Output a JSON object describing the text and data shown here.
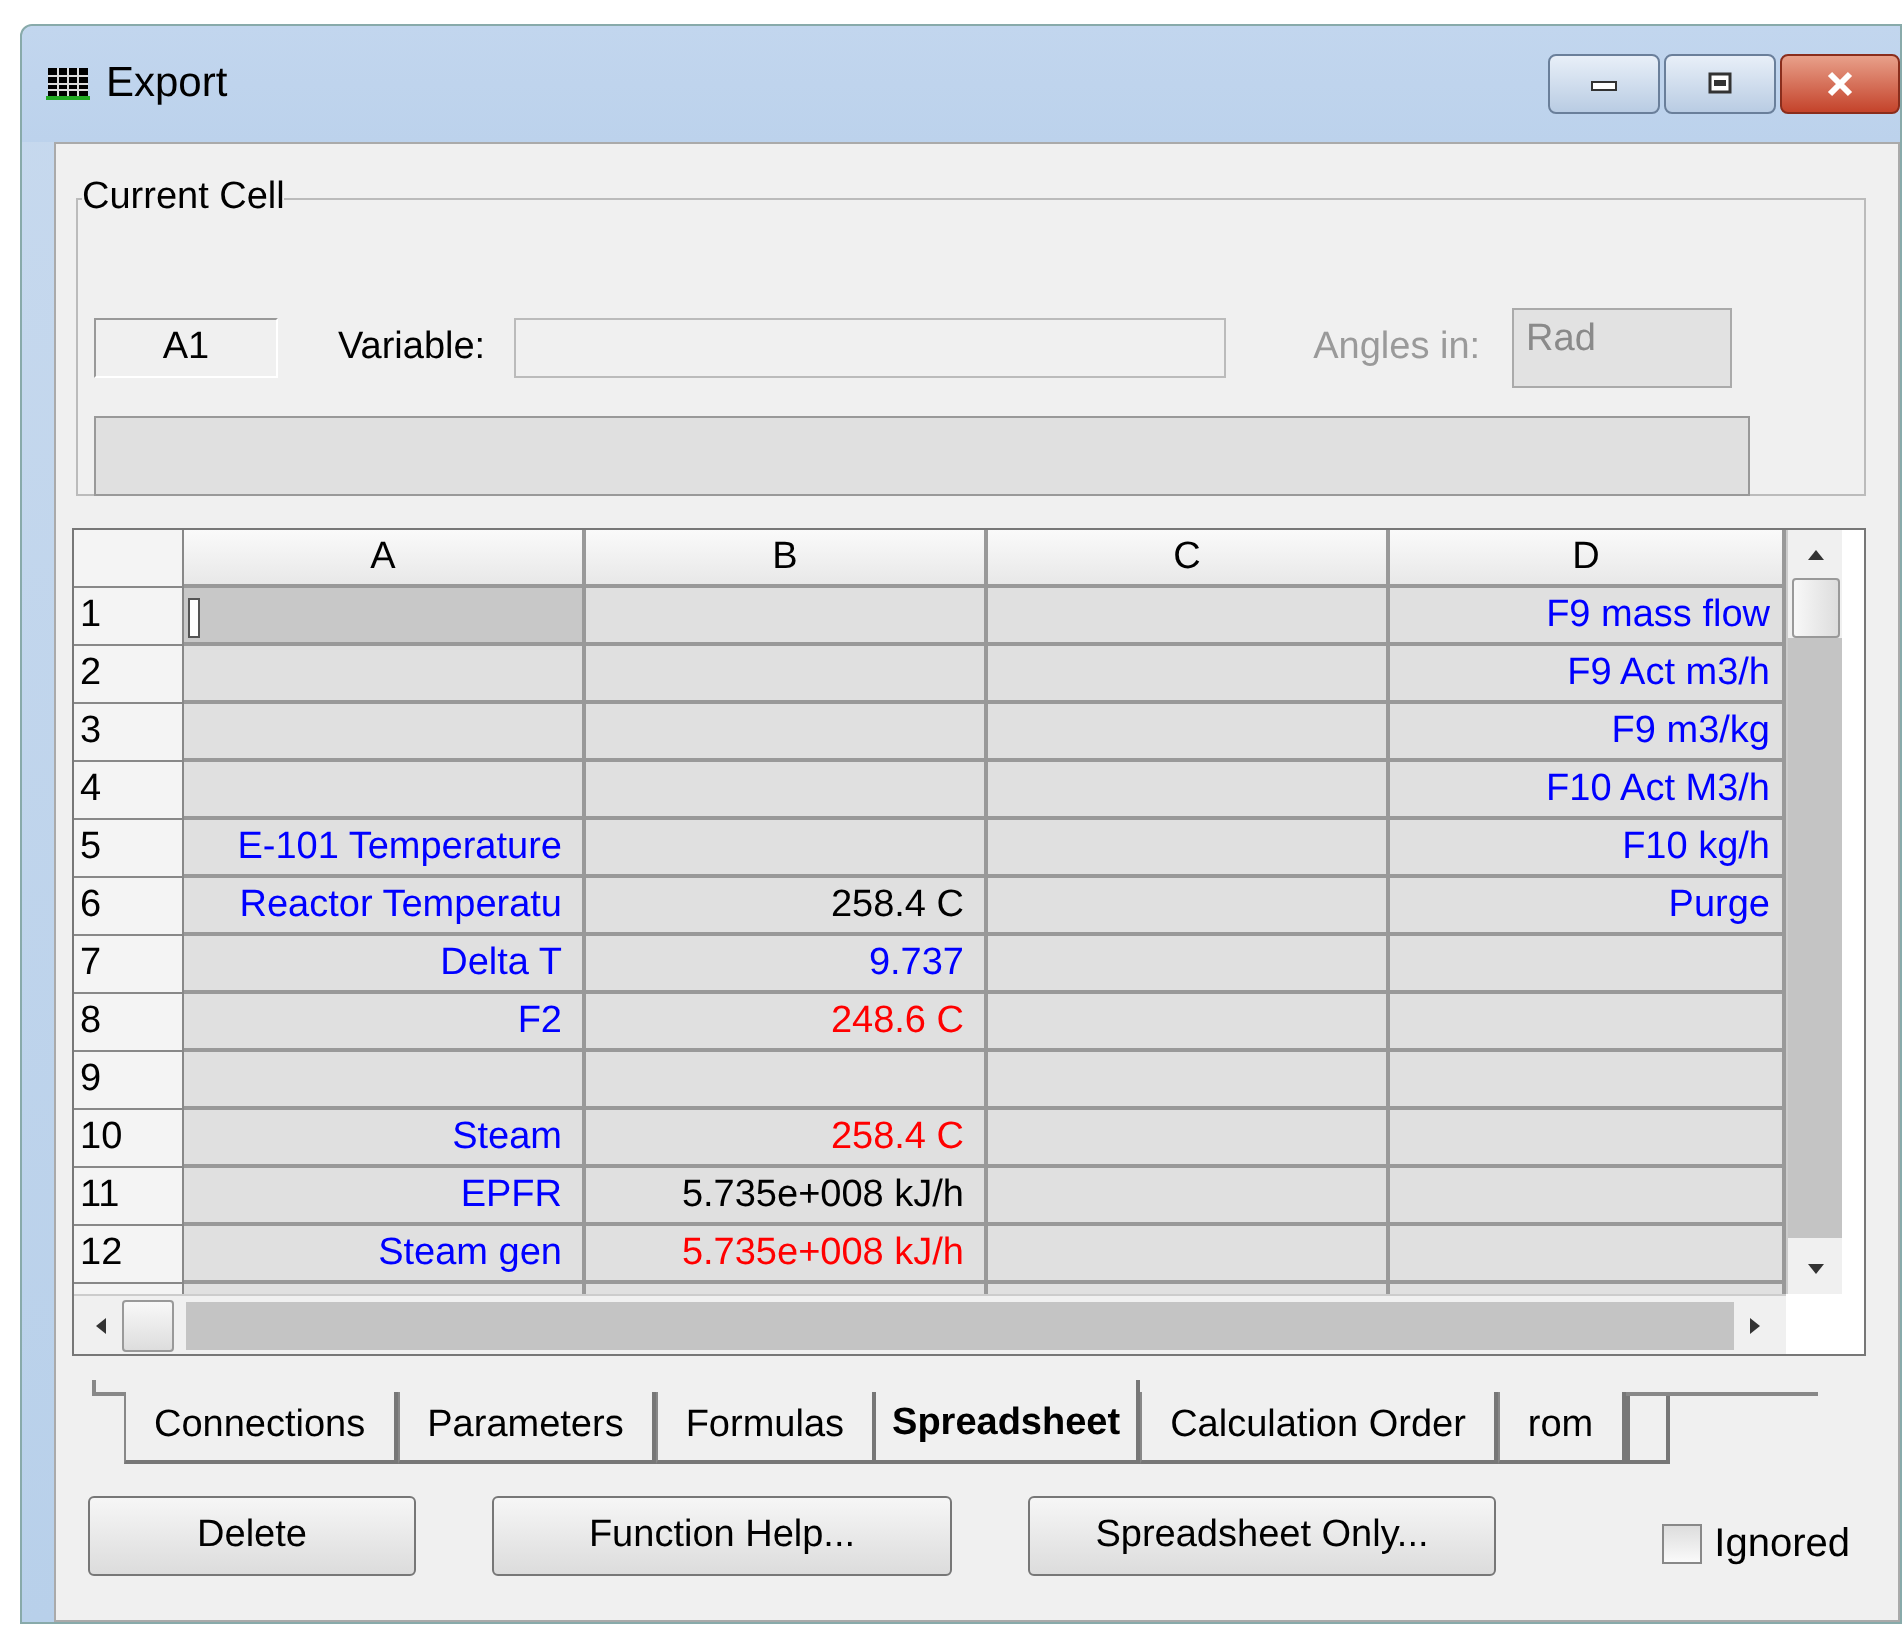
{
  "window": {
    "title": "Export"
  },
  "current_cell": {
    "legend": "Current Cell",
    "cell_ref": "A1",
    "variable_label": "Variable:",
    "angles_label": "Angles in:",
    "angles_value": "Rad"
  },
  "grid": {
    "columns": [
      "A",
      "B",
      "C",
      "D"
    ],
    "rows": [
      {
        "number": "1",
        "cells": [
          {
            "selected": true
          },
          {
            "selected": false
          },
          {
            "selected": false
          },
          {
            "selected": false,
            "text": "F9 mass flow",
            "color": "#0000ff"
          }
        ]
      },
      {
        "number": "2",
        "cells": [
          {
            "selected": false
          },
          {
            "selected": false
          },
          {
            "selected": false
          },
          {
            "selected": false,
            "text": "F9 Act m3/h",
            "color": "#0000ff"
          }
        ]
      },
      {
        "number": "3",
        "cells": [
          {
            "selected": false
          },
          {
            "selected": false
          },
          {
            "selected": false
          },
          {
            "selected": false,
            "text": "F9 m3/kg",
            "color": "#0000ff"
          }
        ]
      },
      {
        "number": "4",
        "cells": [
          {
            "selected": false
          },
          {
            "selected": false
          },
          {
            "selected": false
          },
          {
            "selected": false,
            "text": "F10 Act M3/h",
            "color": "#0000ff"
          }
        ]
      },
      {
        "number": "5",
        "cells": [
          {
            "selected": false,
            "text": "E-101 Temperature",
            "color": "#0000ff"
          },
          {
            "selected": false
          },
          {
            "selected": false
          },
          {
            "selected": false,
            "text": "F10 kg/h",
            "color": "#0000ff"
          }
        ]
      },
      {
        "number": "6",
        "cells": [
          {
            "selected": false,
            "text": "Reactor Temperatu",
            "color": "#0000ff"
          },
          {
            "selected": false,
            "text": "258.4 C",
            "color": "#000000"
          },
          {
            "selected": false
          },
          {
            "selected": false,
            "text": "Purge",
            "color": "#0000ff"
          }
        ]
      },
      {
        "number": "7",
        "cells": [
          {
            "selected": false,
            "text": "Delta T",
            "color": "#0000ff"
          },
          {
            "selected": false,
            "text": "9.737",
            "color": "#0000ff"
          },
          {
            "selected": false
          },
          {
            "selected": false
          }
        ]
      },
      {
        "number": "8",
        "cells": [
          {
            "selected": false,
            "text": "F2",
            "color": "#0000ff"
          },
          {
            "selected": false,
            "text": "248.6 C",
            "color": "#ff0000"
          },
          {
            "selected": false
          },
          {
            "selected": false
          }
        ]
      },
      {
        "number": "9",
        "cells": [
          {
            "selected": false
          },
          {
            "selected": false
          },
          {
            "selected": false
          },
          {
            "selected": false
          }
        ]
      },
      {
        "number": "10",
        "cells": [
          {
            "selected": false,
            "text": "Steam",
            "color": "#0000ff"
          },
          {
            "selected": false,
            "text": "258.4 C",
            "color": "#ff0000"
          },
          {
            "selected": false
          },
          {
            "selected": false
          }
        ]
      },
      {
        "number": "11",
        "cells": [
          {
            "selected": false,
            "text": "EPFR",
            "color": "#0000ff"
          },
          {
            "selected": false,
            "text": "5.735e+008 kJ/h",
            "color": "#000000"
          },
          {
            "selected": false
          },
          {
            "selected": false
          }
        ]
      },
      {
        "number": "12",
        "cells": [
          {
            "selected": false,
            "text": "Steam gen",
            "color": "#0000ff"
          },
          {
            "selected": false,
            "text": "5.735e+008 kJ/h",
            "color": "#ff0000"
          },
          {
            "selected": false
          },
          {
            "selected": false
          }
        ]
      }
    ]
  },
  "tabs": [
    {
      "label": "Connections",
      "selected": false
    },
    {
      "label": "Parameters",
      "selected": false
    },
    {
      "label": "Formulas",
      "selected": false
    },
    {
      "label": "Spreadsheet",
      "selected": true
    },
    {
      "label": "Calculation Order",
      "selected": false
    },
    {
      "label": "rom",
      "selected": false
    }
  ],
  "buttons": [
    "Delete",
    "Function Help...",
    "Spreadsheet Only..."
  ],
  "ignored": {
    "label": "Ignored",
    "checked": false
  }
}
